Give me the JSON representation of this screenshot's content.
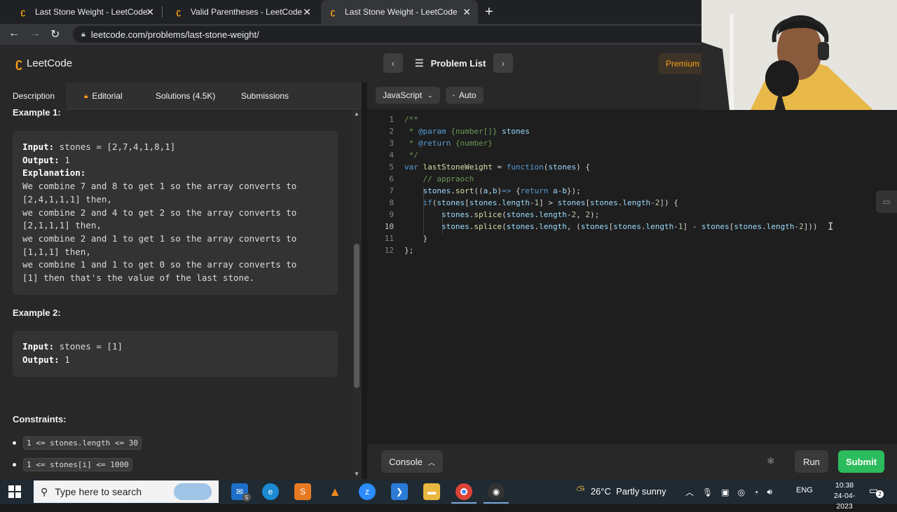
{
  "browser": {
    "tabs": [
      {
        "title": "Last Stone Weight - LeetCode",
        "active": false
      },
      {
        "title": "Valid Parentheses - LeetCode",
        "active": false
      },
      {
        "title": "Last Stone Weight - LeetCode",
        "active": true
      }
    ],
    "url": "leetcode.com/problems/last-stone-weight/"
  },
  "header": {
    "logo_text": "LeetCode",
    "problem_list_label": "Problem List",
    "premium_label": "Premium"
  },
  "left_tabs": [
    {
      "label": "Description",
      "active": true
    },
    {
      "label": "Editorial",
      "active": false
    },
    {
      "label": "Solutions (4.5K)",
      "active": false
    },
    {
      "label": "Submissions",
      "active": false
    }
  ],
  "description": {
    "example1_label": "Example 1:",
    "example1_lines": [
      {
        "key": "Input:",
        "text": " stones = [2,7,4,1,8,1]"
      },
      {
        "key": "Output:",
        "text": " 1"
      },
      {
        "key": "Explanation:",
        "text": ""
      },
      {
        "key": "",
        "text": "We combine 7 and 8 to get 1 so the array converts to"
      },
      {
        "key": "",
        "text": "[2,4,1,1,1] then,"
      },
      {
        "key": "",
        "text": "we combine 2 and 4 to get 2 so the array converts to"
      },
      {
        "key": "",
        "text": "[2,1,1,1] then,"
      },
      {
        "key": "",
        "text": "we combine 2 and 1 to get 1 so the array converts to"
      },
      {
        "key": "",
        "text": "[1,1,1] then,"
      },
      {
        "key": "",
        "text": "we combine 1 and 1 to get 0 so the array converts to"
      },
      {
        "key": "",
        "text": "[1] then that's the value of the last stone."
      }
    ],
    "example2_label": "Example 2:",
    "example2_lines": [
      {
        "key": "Input:",
        "text": " stones = [1]"
      },
      {
        "key": "Output:",
        "text": " 1"
      }
    ],
    "constraints_label": "Constraints:",
    "constraints": [
      "1 <= stones.length <= 30",
      "1 <= stones[i] <= 1000"
    ]
  },
  "editor": {
    "language": "JavaScript",
    "mode": "Auto",
    "line_numbers": [
      "1",
      "2",
      "3",
      "4",
      "5",
      "6",
      "7",
      "8",
      "9",
      "10",
      "11",
      "12"
    ],
    "current_line": "10",
    "console_label": "Console",
    "run_label": "Run",
    "submit_label": "Submit"
  },
  "taskbar": {
    "search_placeholder": "Type here to search",
    "weather": "26°C  Partly sunny",
    "language": "ENG",
    "time": "10:38",
    "date": "24-04-2023",
    "mail_badge": "5",
    "notif_count": "2"
  }
}
